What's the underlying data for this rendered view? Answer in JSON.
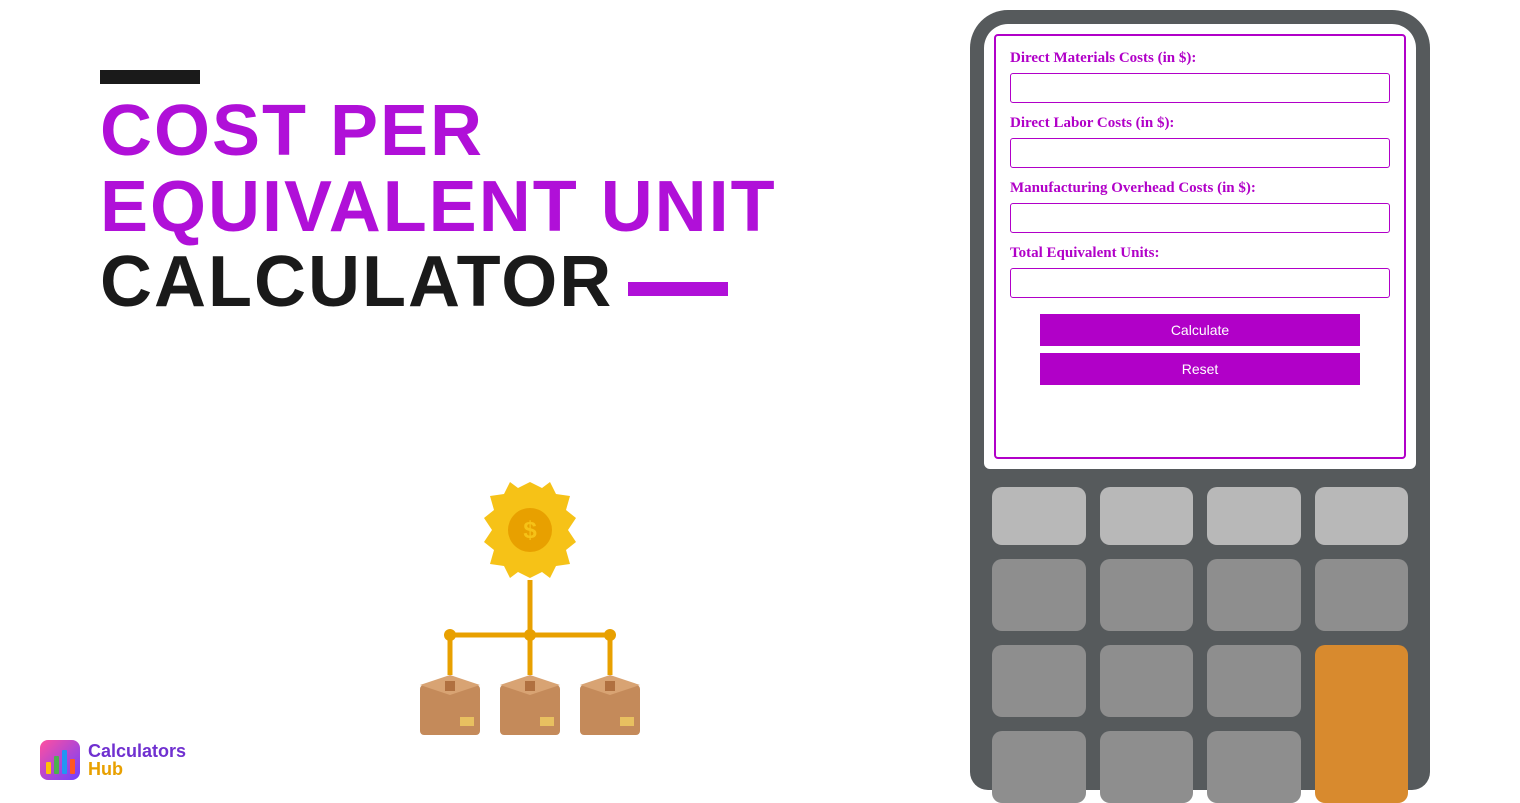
{
  "title": {
    "line1a": "Cost Per",
    "line1b": "Equivalent Unit",
    "line2": "Calculator"
  },
  "form": {
    "fields": [
      {
        "label": "Direct Materials Costs (in $):"
      },
      {
        "label": "Direct Labor Costs (in $):"
      },
      {
        "label": "Manufacturing Overhead Costs (in $):"
      },
      {
        "label": "Total Equivalent Units:"
      }
    ],
    "calculate": "Calculate",
    "reset": "Reset"
  },
  "logo": {
    "word1": "Calculators",
    "word2": "Hub"
  }
}
